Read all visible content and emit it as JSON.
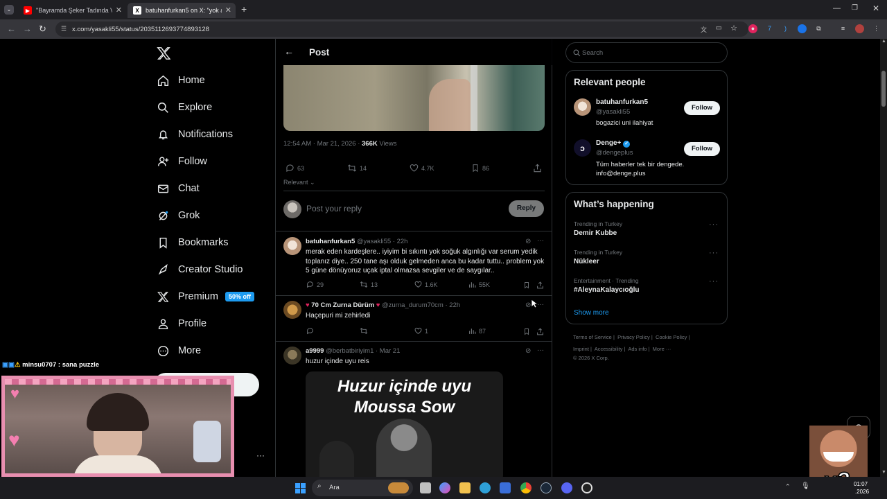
{
  "browser": {
    "tabs": [
      {
        "title": "\"Bayramda Şeker Tadında Video",
        "active": false
      },
      {
        "title": "batuhanfurkan5 on X: \"yok ana",
        "active": true
      }
    ],
    "url": "x.com/yasakli55/status/2035112693774893128"
  },
  "sidebar": {
    "items": [
      {
        "label": "Home",
        "icon": "home-icon"
      },
      {
        "label": "Explore",
        "icon": "search-icon"
      },
      {
        "label": "Notifications",
        "icon": "bell-icon"
      },
      {
        "label": "Follow",
        "icon": "person-add-icon"
      },
      {
        "label": "Chat",
        "icon": "mail-icon"
      },
      {
        "label": "Grok",
        "icon": "grok-icon"
      },
      {
        "label": "Bookmarks",
        "icon": "bookmark-icon"
      },
      {
        "label": "Creator Studio",
        "icon": "rocket-icon"
      },
      {
        "label": "Premium",
        "icon": "x-logo-icon",
        "badge": "50% off"
      },
      {
        "label": "Profile",
        "icon": "person-icon"
      },
      {
        "label": "More",
        "icon": "more-circle-icon"
      }
    ]
  },
  "header": {
    "title": "Post"
  },
  "post": {
    "timestamp": "12:54 AM · Mar 21, 2026 · ",
    "views_count": "366K",
    "views_label": " Views",
    "replies": "63",
    "reposts": "14",
    "likes": "4.7K",
    "bookmarks": "86",
    "sort_label": "Relevant"
  },
  "reply_box": {
    "placeholder": "Post your reply",
    "button": "Reply"
  },
  "replies": [
    {
      "name": "batuhanfurkan5",
      "handle": "@yasakli55 · 22h",
      "text": "merak eden kardeşlere.. iyiyim bi sıkıntı yok soğuk algınlığı var serum yedik toplanız diye.. 250 tane aşı olduk gelmeden anca bu kadar tuttu.. problem yok 5 güne dönüyoruz uçak iptal olmazsa sevgiler ve de saygılar..",
      "replies": "29",
      "reposts": "13",
      "likes": "1.6K",
      "views": "55K"
    },
    {
      "name": "70 Cm Zurna Dürüm",
      "handle": "@zurna_durum70cm · 22h",
      "text": "Haçepuri mi zehirledi",
      "replies": "",
      "reposts": "",
      "likes": "1",
      "views": "87"
    },
    {
      "name": "a9999",
      "handle": "@berbatbiriyim1 · Mar 21",
      "text": "huzur içinde uyu reis",
      "image_line1": "Huzur içinde uyu",
      "image_line2": "Moussa Sow"
    }
  ],
  "search": {
    "placeholder": "Search"
  },
  "relevant_people": {
    "title": "Relevant people",
    "people": [
      {
        "name": "batuhanfurkan5",
        "handle": "@yasakli55",
        "bio": "bogazici uni ilahiyat",
        "button": "Follow"
      },
      {
        "name": "Denge+",
        "handle": "@dengeplus",
        "bio": "Tüm haberler tek bir dengede. info@denge.plus",
        "button": "Follow"
      }
    ]
  },
  "whats_happening": {
    "title": "What’s happening",
    "trends": [
      {
        "meta": "Trending in Turkey",
        "name": "Demir Kubbe"
      },
      {
        "meta": "Trending in Turkey",
        "name": "Nükleer"
      },
      {
        "meta": "Entertainment · Trending",
        "name": "#AleynaKalaycıoğlu"
      }
    ],
    "show_more": "Show more"
  },
  "footer": {
    "row1": [
      "Terms of Service",
      "Privacy Policy",
      "Cookie Policy"
    ],
    "row2": [
      "Imprint",
      "Accessibility",
      "Ads info",
      "More ···"
    ],
    "copyright": "© 2026 X Corp."
  },
  "stream": {
    "chat_user": "minsu0707",
    "chat_message": " : sana puzzle",
    "overlay_text": "x3"
  },
  "taskbar": {
    "search_label": "Ara",
    "clock_time": "01:07",
    "clock_date": ".2026"
  },
  "colors": {
    "accent": "#1d9bf0",
    "background": "#000000",
    "border": "#2f3336",
    "muted": "#71767b",
    "heart": "#f91880"
  }
}
